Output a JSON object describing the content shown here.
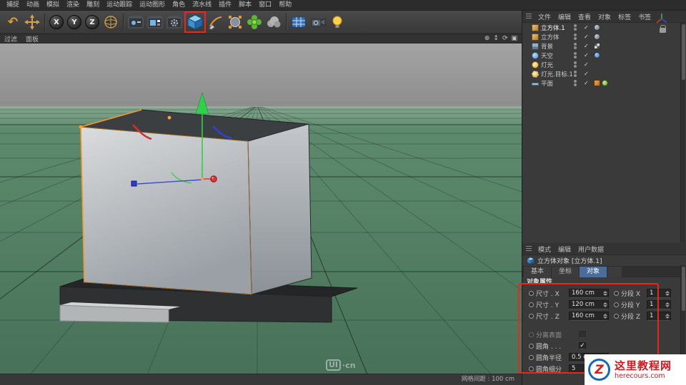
{
  "menubar": {
    "items": [
      "捕捉",
      "动画",
      "模拟",
      "渲染",
      "雕刻",
      "运动跟踪",
      "运动图形",
      "角色",
      "流水线",
      "插件",
      "脚本",
      "窗口",
      "帮助"
    ]
  },
  "toolbar": {
    "undo_glyph": "↶",
    "axis_buttons": [
      "X",
      "Y",
      "Z"
    ]
  },
  "viewport": {
    "menu": [
      "过滤",
      "面板"
    ],
    "controls": {
      "pan": "⊕",
      "zoom": "↕",
      "rotate": "⟳",
      "toggle": "▣"
    },
    "grid_status": "网格间距 : 100 cm",
    "watermark": {
      "logo": "UI",
      "suffix": "·cn"
    }
  },
  "object_manager": {
    "menus": [
      "文件",
      "编辑",
      "查看",
      "对象",
      "标签",
      "书签"
    ],
    "check": "✓",
    "objects": [
      {
        "name": "立方体.1"
      },
      {
        "name": "立方体"
      },
      {
        "name": "背景"
      },
      {
        "name": "天空"
      },
      {
        "name": "灯光"
      },
      {
        "name": "灯光.目标.1"
      },
      {
        "name": "平面"
      }
    ]
  },
  "attributes": {
    "menus": [
      "模式",
      "编辑",
      "用户数据"
    ],
    "title": "立方体对象 [立方体.1]",
    "tabs": [
      "基本",
      "坐标",
      "对象"
    ],
    "section": "对象属性",
    "rows": [
      {
        "label": "尺寸 . X",
        "value": "160 cm",
        "label2": "分段 X",
        "value2": "1"
      },
      {
        "label": "尺寸 . Y",
        "value": "120 cm",
        "label2": "分段 Y",
        "value2": "1"
      },
      {
        "label": "尺寸 . Z",
        "value": "160 cm",
        "label2": "分段 Z",
        "value2": "1"
      }
    ],
    "separate": {
      "label": "分离表面"
    },
    "fillet": {
      "label": "圆角 . . .",
      "mark": "✓"
    },
    "radius": {
      "label": "圆角半径",
      "value": "0.5 cm"
    },
    "subdiv": {
      "label": "圆角细分",
      "value": "5"
    }
  },
  "badge": {
    "logo": "Z",
    "line1": "这里教程网",
    "line2": "herecours.com"
  }
}
